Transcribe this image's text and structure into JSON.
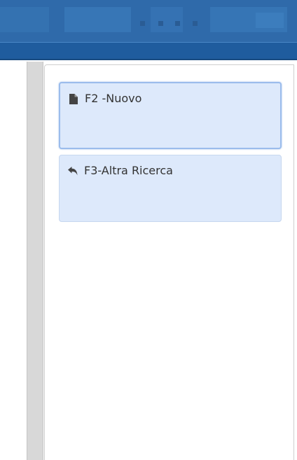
{
  "colors": {
    "banner": "#2f6aaa",
    "strip": "#1f5c9e",
    "button_bg": "#dde9fb",
    "button_border": "#c6d7ef",
    "text": "#333333",
    "icon": "#444444"
  },
  "actions": [
    {
      "label": "F2 -Nuovo",
      "icon": "file-icon",
      "focused": true
    },
    {
      "label": "F3-Altra Ricerca",
      "icon": "reply-icon",
      "focused": false
    }
  ]
}
